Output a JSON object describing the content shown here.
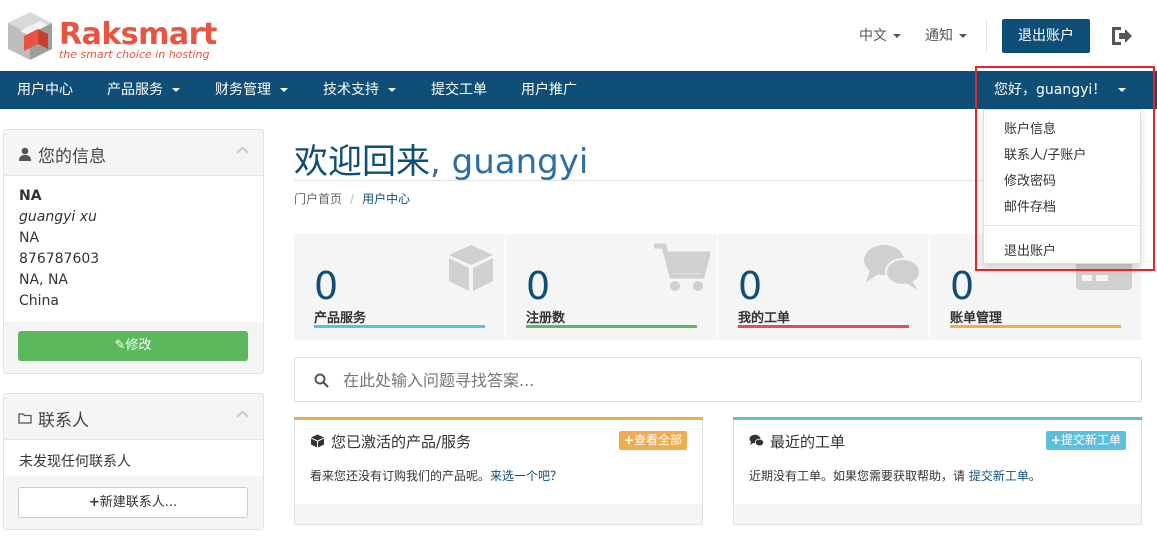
{
  "header": {
    "logo_brand": "Raksmart",
    "logo_tagline": "the smart choice in hosting",
    "language": "中文",
    "notifications": "通知",
    "logout_button": "退出账户",
    "logout_icon": "sign-out-icon"
  },
  "nav": {
    "items": [
      {
        "label": "用户中心",
        "dropdown": false
      },
      {
        "label": "产品服务",
        "dropdown": true
      },
      {
        "label": "财务管理",
        "dropdown": true
      },
      {
        "label": "技术支持",
        "dropdown": true
      },
      {
        "label": "提交工单",
        "dropdown": false
      },
      {
        "label": "用户推广",
        "dropdown": false
      }
    ],
    "user_greeting": "您好，guangyi！"
  },
  "user_dropdown": {
    "items": [
      "账户信息",
      "联系人/子账户",
      "修改密码",
      "邮件存档"
    ],
    "logout": "退出账户"
  },
  "sidebar": {
    "info_panel": {
      "title": "您的信息",
      "company": "NA",
      "name": "guangyi xu",
      "address1": "NA",
      "phone": "876787603",
      "city_state": "NA, NA",
      "country": "China",
      "edit_button": "修改"
    },
    "contacts_panel": {
      "title": "联系人",
      "empty_text": "未发现任何联系人",
      "new_button": "新建联系人..."
    }
  },
  "main": {
    "welcome_prefix": "欢迎回来",
    "welcome_user": ", guangyi",
    "breadcrumb": {
      "home": "门户首页",
      "current": "用户中心"
    },
    "tiles": [
      {
        "count": "0",
        "label": "产品服务",
        "color": "#5bc0de",
        "icon": "cube-icon"
      },
      {
        "count": "0",
        "label": "注册数",
        "color": "#5cb85c",
        "icon": "shopping-cart-icon"
      },
      {
        "count": "0",
        "label": "我的工单",
        "color": "#d9534f",
        "icon": "comments-icon"
      },
      {
        "count": "0",
        "label": "账单管理",
        "color": "#f0ad4e",
        "icon": "credit-card-icon"
      }
    ],
    "search": {
      "placeholder": "在此处输入问题寻找答案..."
    },
    "products_card": {
      "title": "您已激活的产品/服务",
      "badge": "查看全部",
      "body_text": "看来您还没有订购我们的产品呢。",
      "body_link": "来选一个吧",
      "body_suffix": "？",
      "accent": "#f0ad4e"
    },
    "tickets_card": {
      "title": "最近的工单",
      "badge": "提交新工单",
      "body_text": "近期没有工单。如果您需要获取帮助，请 ",
      "body_link": "提交新工单",
      "body_suffix": "。",
      "accent": "#5bc0de"
    }
  },
  "colors": {
    "primary": "#0f4f77",
    "logo": "#e8543f",
    "highlight": "#e5252b"
  }
}
